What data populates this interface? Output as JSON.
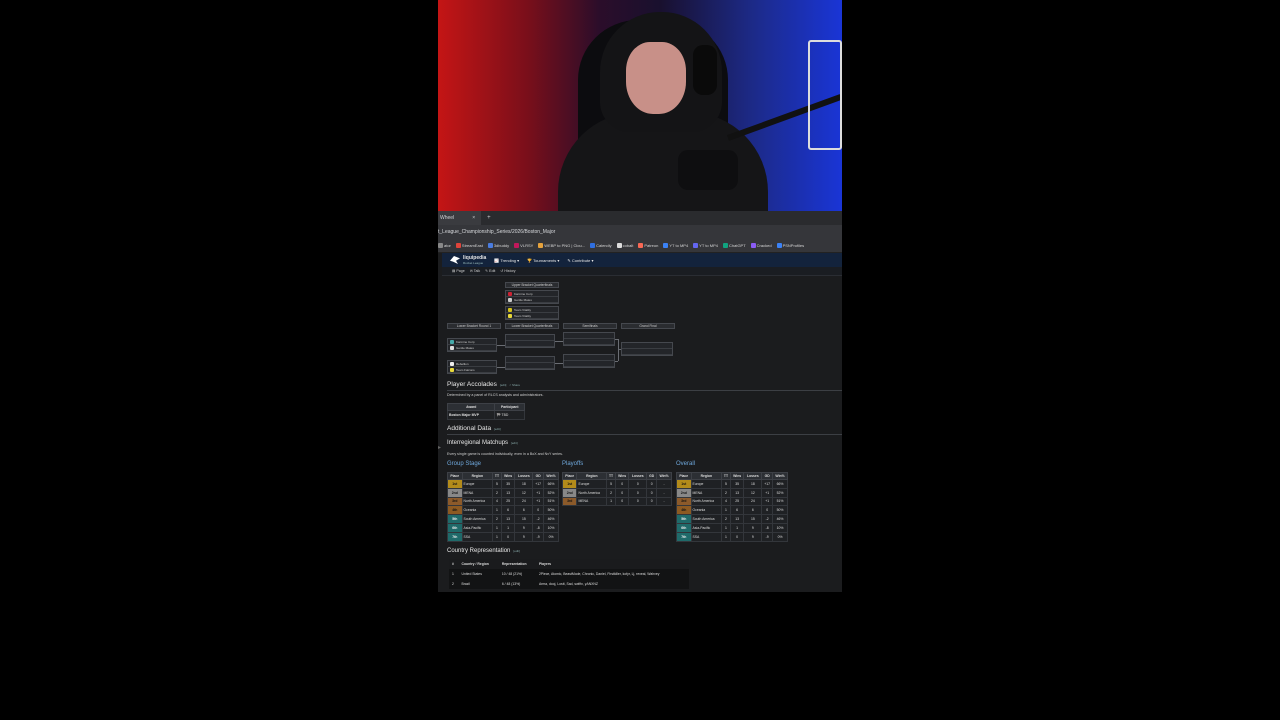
{
  "browser": {
    "tab_title": "Wheel",
    "tab_close": "×",
    "new_tab": "+",
    "url": "t_League_Championship_Series/2026/Boston_Major",
    "bookmarks": [
      {
        "label": "ator",
        "color": "#888"
      },
      {
        "label": "StreamEast",
        "color": "#e0443a"
      },
      {
        "label": "3dbuddy",
        "color": "#4a7ce0"
      },
      {
        "label": "VLRSY",
        "color": "#c2185b"
      },
      {
        "label": "WEBP to PNG | Clou...",
        "color": "#e6a23c"
      },
      {
        "label": "Calendly",
        "color": "#2f6fe0"
      },
      {
        "label": "cobalt",
        "color": "#dddddd"
      },
      {
        "label": "Patreon",
        "color": "#f96854"
      },
      {
        "label": "YT to MP4",
        "color": "#3b82f6"
      },
      {
        "label": "YT to MP4",
        "color": "#6366f1"
      },
      {
        "label": "ChatGPT",
        "color": "#10a37f"
      },
      {
        "label": "Cracked",
        "color": "#8b5cf6"
      },
      {
        "label": "PSNProfiles",
        "color": "#3b82f6"
      }
    ]
  },
  "site": {
    "name": "liquipedia",
    "sub": "Rocket League",
    "nav": [
      "Trending",
      "Tournaments",
      "Contribute"
    ],
    "page_tabs": [
      "Page",
      "Talk",
      "Edit",
      "History"
    ]
  },
  "bracket": {
    "headers": {
      "ubqf": "Upper Bracket Quarterfinals",
      "lbr1": "Lower Bracket Round 1",
      "lbqf": "Lower Bracket Quarterfinals",
      "sf": "Semifinals",
      "gf": "Grand Final"
    },
    "ub_match1": [
      {
        "team": "Karmine Corp",
        "icon": "#c23"
      },
      {
        "team": "Gentle Mates",
        "icon": "#ccc"
      }
    ],
    "ub_match2": [
      {
        "team": "Team Vitality",
        "icon": "#d4c21a"
      },
      {
        "team": "Team Vitality",
        "icon": "#e8d83a"
      }
    ],
    "lb_match1": [
      {
        "team": "Karmine Corp",
        "icon": "#4aa"
      },
      {
        "team": "Gentle Mates",
        "icon": "#ddd"
      }
    ],
    "lb_match2": [
      {
        "team": "Rebellion",
        "icon": "#eee"
      },
      {
        "team": "Team Falcons",
        "icon": "#e8d83a"
      }
    ]
  },
  "accolades": {
    "title": "Player Accolades",
    "edit": "[edit]",
    "share": "< Share",
    "note": "Determined by a panel of RLCS analysts and administrators.",
    "award_header": "Award",
    "participant_header": "Participant",
    "award": "Boston Major MVP",
    "participant": "TBD"
  },
  "additional": {
    "title": "Additional Data",
    "edit": "[edit]"
  },
  "interregional": {
    "title": "Interregional Matchups",
    "edit": "[edit]",
    "note": "Every single game is counted individually, even in a BoX and NvY series."
  },
  "group_stage": {
    "title": "Group Stage",
    "headers": [
      "Place",
      "Region",
      "TT",
      "Wins",
      "Losses",
      "GD",
      "Win%"
    ],
    "rows": [
      [
        "1st",
        "Europe",
        "5",
        "35",
        "18",
        "+17",
        "66%"
      ],
      [
        "2nd",
        "MENA",
        "2",
        "13",
        "12",
        "+1",
        "52%"
      ],
      [
        "3rd",
        "North America",
        "4",
        "25",
        "24",
        "+1",
        "51%"
      ],
      [
        "4th",
        "Oceania",
        "1",
        "6",
        "6",
        "0",
        "50%"
      ],
      [
        "5th",
        "South America",
        "2",
        "13",
        "15",
        "-2",
        "46%"
      ],
      [
        "6th",
        "Asia-Pacific",
        "1",
        "1",
        "9",
        "-8",
        "10%"
      ],
      [
        "7th",
        "SSA",
        "1",
        "0",
        "9",
        "-9",
        "0%"
      ]
    ]
  },
  "playoffs": {
    "title": "Playoffs",
    "headers": [
      "Place",
      "Region",
      "TT",
      "Wins",
      "Losses",
      "GD",
      "Win%"
    ],
    "rows": [
      [
        "1st",
        "Europe",
        "5",
        "0",
        "0",
        "0",
        "-"
      ],
      [
        "2nd",
        "North America",
        "2",
        "0",
        "0",
        "0",
        "-"
      ],
      [
        "3rd",
        "MENA",
        "1",
        "0",
        "0",
        "0",
        "-"
      ]
    ]
  },
  "overall": {
    "title": "Overall",
    "headers": [
      "Place",
      "Region",
      "TT",
      "Wins",
      "Losses",
      "GD",
      "Win%"
    ],
    "rows": [
      [
        "1st",
        "Europe",
        "5",
        "35",
        "18",
        "+17",
        "66%"
      ],
      [
        "2nd",
        "MENA",
        "2",
        "13",
        "12",
        "+1",
        "52%"
      ],
      [
        "3rd",
        "North America",
        "4",
        "25",
        "24",
        "+1",
        "51%"
      ],
      [
        "4th",
        "Oceania",
        "1",
        "6",
        "6",
        "0",
        "50%"
      ],
      [
        "5th",
        "South America",
        "2",
        "13",
        "15",
        "-2",
        "46%"
      ],
      [
        "6th",
        "Asia-Pacific",
        "1",
        "1",
        "9",
        "-8",
        "10%"
      ],
      [
        "7th",
        "SSA",
        "1",
        "0",
        "9",
        "-9",
        "0%"
      ]
    ]
  },
  "country": {
    "title": "Country Representation",
    "edit": "[edit]",
    "headers": [
      "#",
      "Country / Region",
      "Representation",
      "Players"
    ],
    "rows": [
      [
        "1",
        "United States",
        "10 / 48 (21%)",
        "2Piece, Atomic, BeastMode, Chronic, Daniel, Firstkiller, kofyr, Lj, rexeal, Wahvey"
      ],
      [
        "2",
        "Brazil",
        "6 / 48 (13%)",
        "Arma, dooj, Lostt, Sad, swiftx, yANXNZ"
      ]
    ]
  }
}
